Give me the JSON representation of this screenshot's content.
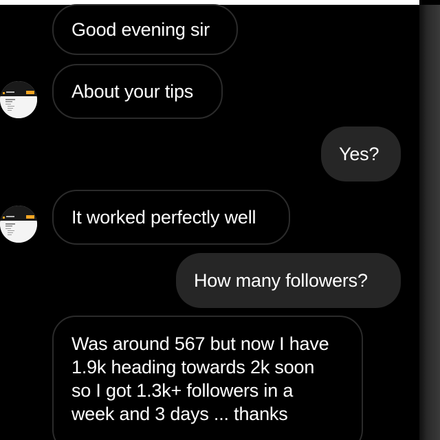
{
  "messages": [
    {
      "side": "incoming",
      "text": "Good evening sir"
    },
    {
      "side": "incoming",
      "text": "About your tips"
    },
    {
      "side": "outgoing",
      "text": "Yes?"
    },
    {
      "side": "incoming",
      "text": "It worked perfectly well"
    },
    {
      "side": "outgoing",
      "text": "How many followers?"
    },
    {
      "side": "incoming",
      "lines": [
        "Was around 567 but now I have",
        "1.9k heading towards 2k soon",
        "so I got 1.3k+ followers  in a",
        "week and 3 days ... thanks"
      ]
    }
  ],
  "colors": {
    "background": "#000000",
    "outgoing_bubble": "#262626",
    "incoming_border": "#2b2b2b",
    "text": "#ffffff",
    "avatar_accent": "#f5a623"
  },
  "icons": [
    "contact-avatar"
  ]
}
